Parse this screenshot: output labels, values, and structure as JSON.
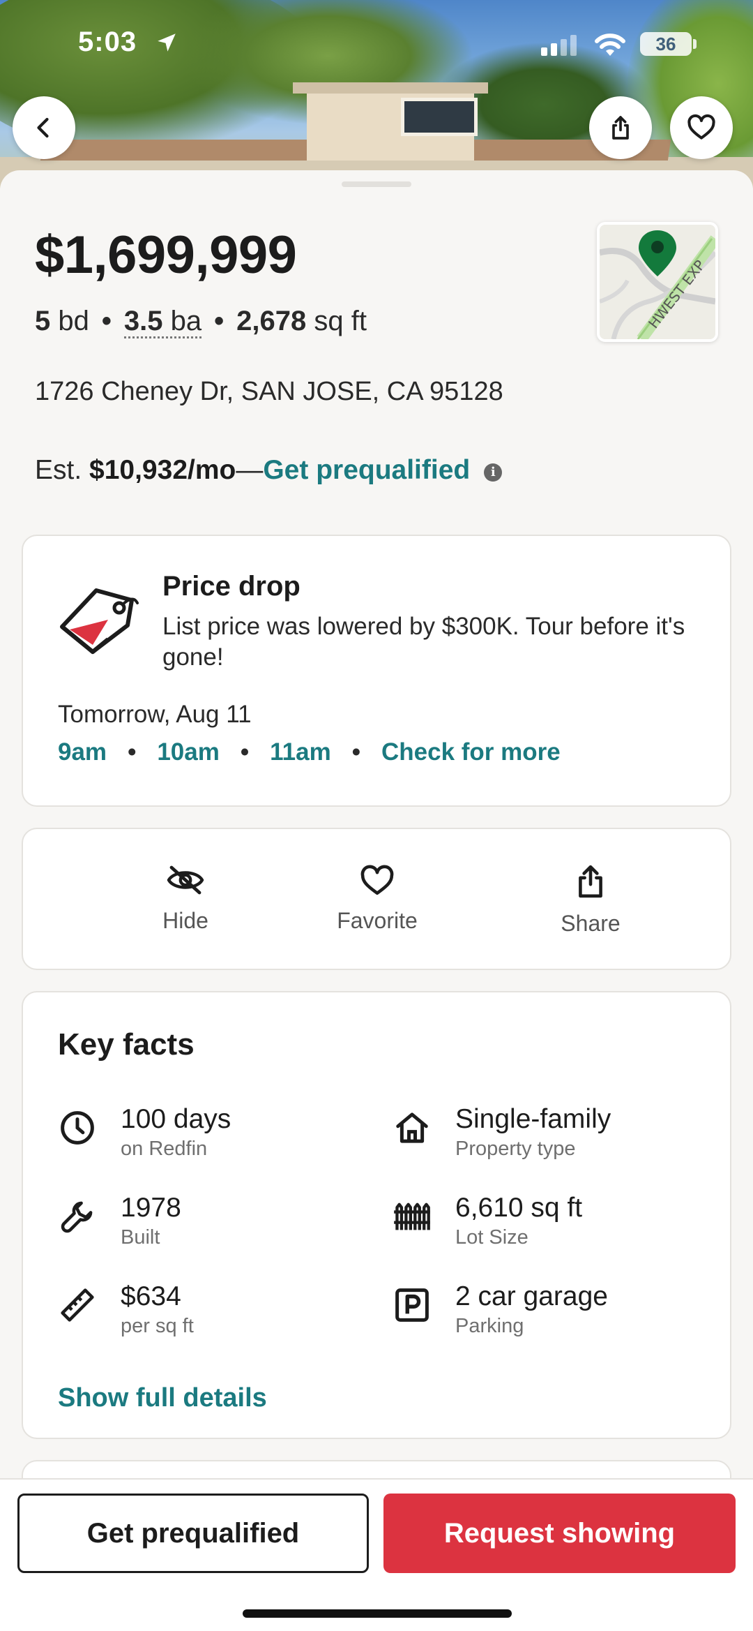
{
  "status_bar": {
    "time": "5:03",
    "battery": "36"
  },
  "listing": {
    "price": "$1,699,999",
    "beds": "5",
    "beds_unit": "bd",
    "baths": "3.5",
    "baths_unit": "ba",
    "sqft": "2,678",
    "sqft_unit": "sq ft",
    "address": "1726 Cheney Dr, SAN JOSE, CA 95128",
    "map_label": "HWEST EXP"
  },
  "estimate": {
    "prefix": "Est.",
    "amount": "$10,932/mo",
    "dash": "—",
    "link": "Get prequalified",
    "info": "i"
  },
  "price_drop": {
    "title": "Price drop",
    "text": "List price was lowered by $300K. Tour before it's gone!",
    "date": "Tomorrow, Aug 11",
    "times": [
      "9am",
      "10am",
      "11am"
    ],
    "more": "Check for more"
  },
  "actions": {
    "hide": "Hide",
    "favorite": "Favorite",
    "share": "Share"
  },
  "key_facts": {
    "title": "Key facts",
    "items": [
      {
        "value": "100 days",
        "sub": "on Redfin",
        "icon": "clock-icon"
      },
      {
        "value": "Single-family",
        "sub": "Property type",
        "icon": "house-icon"
      },
      {
        "value": "1978",
        "sub": "Built",
        "icon": "wrench-icon"
      },
      {
        "value": "6,610 sq ft",
        "sub": "Lot Size",
        "icon": "fence-icon"
      },
      {
        "value": "$634",
        "sub": "per sq ft",
        "icon": "ruler-icon"
      },
      {
        "value": "2 car garage",
        "sub": "Parking",
        "icon": "parking-icon"
      }
    ],
    "show_full": "Show full details"
  },
  "bottom": {
    "prequalified": "Get prequalified",
    "request": "Request showing"
  },
  "colors": {
    "accent": "#1b7a80",
    "primary_button": "#dc3340",
    "map_pin": "#137a3c"
  }
}
